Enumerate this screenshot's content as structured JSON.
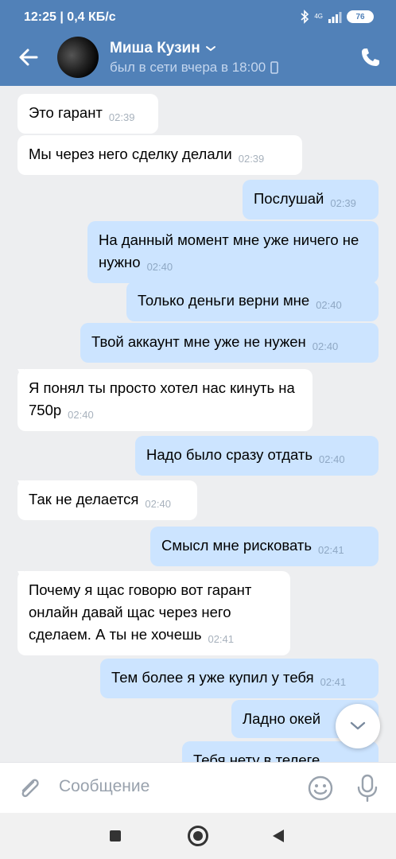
{
  "status_bar": {
    "time": "12:25 | 0,4 КБ/с",
    "network": "4G",
    "battery": "76"
  },
  "header": {
    "contact_name": "Миша Кузин",
    "contact_status": "был в сети вчера в 18:00",
    "icons": {
      "back": "arrow-left-icon",
      "call": "phone-icon",
      "expand": "chevron-down-icon"
    }
  },
  "messages": [
    {
      "dir": "in",
      "text": "Это гарант",
      "time": "02:39"
    },
    {
      "dir": "in",
      "text": "Мы через него сделку делали",
      "time": "02:39"
    },
    {
      "dir": "out",
      "text": "Послушай",
      "time": "02:39"
    },
    {
      "dir": "out",
      "text": "На данный момент мне уже ничего не нужно",
      "time": "02:40"
    },
    {
      "dir": "out",
      "text": "Только деньги верни мне",
      "time": "02:40"
    },
    {
      "dir": "out",
      "text": "Твой аккаунт мне уже не нужен",
      "time": "02:40"
    },
    {
      "dir": "in",
      "text": "Я понял ты просто хотел нас кинуть на 750р",
      "time": "02:40"
    },
    {
      "dir": "out",
      "text": "Надо было сразу отдать",
      "time": "02:40"
    },
    {
      "dir": "in",
      "text": "Так не делается",
      "time": "02:40"
    },
    {
      "dir": "out",
      "text": "Смысл мне рисковать",
      "time": "02:41"
    },
    {
      "dir": "in",
      "text": "Почему я щас говорю вот гарант онлайн давай щас через него сделаем. А ты не хочешь",
      "time": "02:41"
    },
    {
      "dir": "out",
      "text": "Тем более я уже купил у тебя",
      "time": "02:41"
    },
    {
      "dir": "out",
      "text": "Ладно окей",
      "time": ""
    },
    {
      "dir": "out",
      "text": "Тебя нету в телеге",
      "time": ""
    }
  ],
  "composer": {
    "placeholder": "Сообщение"
  },
  "colors": {
    "header": "#5181b8",
    "incoming_bubble": "#ffffff",
    "outgoing_bubble": "#cce4ff",
    "background": "#edeef0"
  }
}
